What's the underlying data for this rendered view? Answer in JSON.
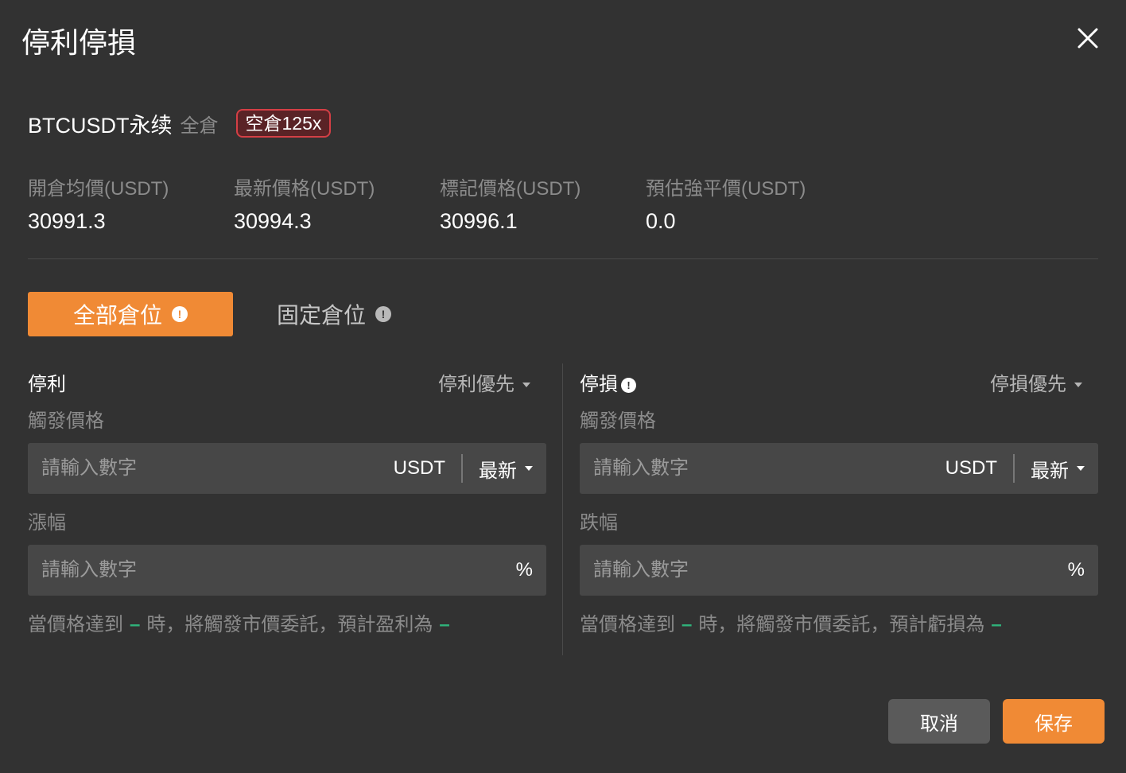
{
  "dialog": {
    "title": "停利停損",
    "close_icon": "close-icon"
  },
  "position": {
    "symbol": "BTCUSDT永续",
    "margin_mode": "全倉",
    "side_badge": "空倉125x",
    "badge_color": "#d43f45"
  },
  "stats": [
    {
      "label": "開倉均價(USDT)",
      "value": "30991.3"
    },
    {
      "label": "最新價格(USDT)",
      "value": "30994.3"
    },
    {
      "label": "標記價格(USDT)",
      "value": "30996.1"
    },
    {
      "label": "預估強平價(USDT)",
      "value": "0.0"
    }
  ],
  "tabs": [
    {
      "label": "全部倉位",
      "active": true
    },
    {
      "label": "固定倉位",
      "active": false
    }
  ],
  "take_profit": {
    "title": "停利",
    "priority": "停利優先",
    "trigger_label": "觸發價格",
    "trigger_placeholder": "請輸入數字",
    "trigger_unit": "USDT",
    "trigger_type": "最新",
    "change_label": "漲幅",
    "change_placeholder": "請輸入數字",
    "change_unit": "%",
    "hint_before": "當價格達到",
    "hint_dash1": "–",
    "hint_middle": "時，將觸發市價委託，預計盈利為",
    "hint_dash2": "–"
  },
  "stop_loss": {
    "title": "停損",
    "priority": "停損優先",
    "trigger_label": "觸發價格",
    "trigger_placeholder": "請輸入數字",
    "trigger_unit": "USDT",
    "trigger_type": "最新",
    "change_label": "跌幅",
    "change_placeholder": "請輸入數字",
    "change_unit": "%",
    "hint_before": "當價格達到",
    "hint_dash1": "–",
    "hint_middle": "時，將觸發市價委託，預計虧損為",
    "hint_dash2": "–"
  },
  "footer": {
    "cancel_label": "取消",
    "save_label": "保存"
  },
  "colors": {
    "accent": "#f08a35",
    "background": "#323232",
    "input_bg": "#474747",
    "positive": "#2fb37a"
  }
}
